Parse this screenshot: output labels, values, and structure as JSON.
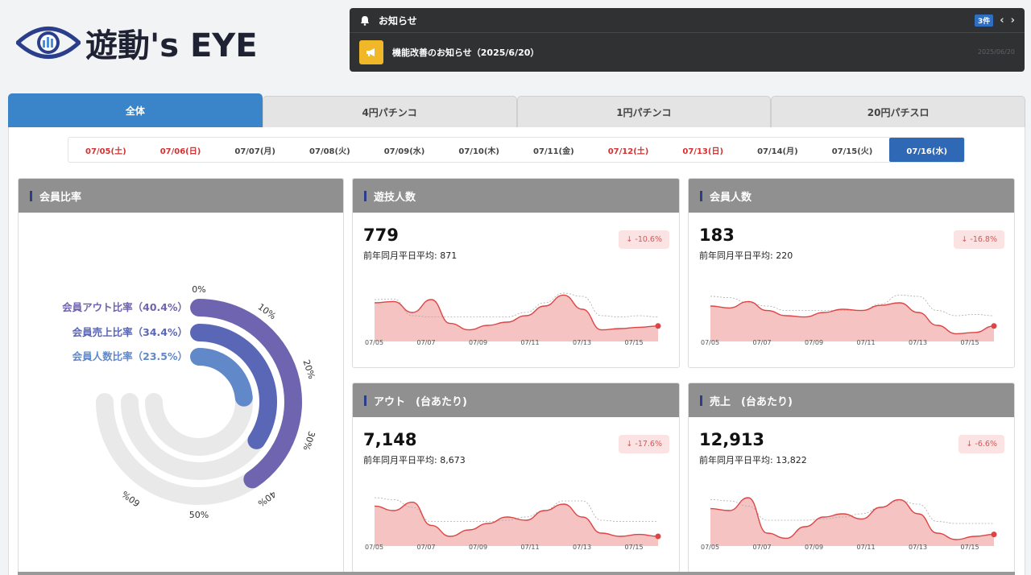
{
  "brand": {
    "logo_text": "遊動's EYE"
  },
  "news": {
    "title": "お知らせ",
    "count": "3件",
    "item_text": "機能改善のお知らせ（2025/6/20）",
    "item_date": "2025/06/20"
  },
  "tabs": [
    {
      "label": "全体",
      "active": true
    },
    {
      "label": "4円パチンコ",
      "active": false
    },
    {
      "label": "1円パチンコ",
      "active": false
    },
    {
      "label": "20円パチスロ",
      "active": false
    }
  ],
  "dates": [
    {
      "label": "07/05(土)",
      "holiday": true,
      "active": false
    },
    {
      "label": "07/06(日)",
      "holiday": true,
      "active": false
    },
    {
      "label": "07/07(月)",
      "holiday": false,
      "active": false
    },
    {
      "label": "07/08(火)",
      "holiday": false,
      "active": false
    },
    {
      "label": "07/09(水)",
      "holiday": false,
      "active": false
    },
    {
      "label": "07/10(木)",
      "holiday": false,
      "active": false
    },
    {
      "label": "07/11(金)",
      "holiday": false,
      "active": false
    },
    {
      "label": "07/12(土)",
      "holiday": true,
      "active": false
    },
    {
      "label": "07/13(日)",
      "holiday": true,
      "active": false
    },
    {
      "label": "07/14(月)",
      "holiday": false,
      "active": false
    },
    {
      "label": "07/15(火)",
      "holiday": false,
      "active": false
    },
    {
      "label": "07/16(水)",
      "holiday": false,
      "active": true
    }
  ],
  "ratio_card": {
    "title": "会員比率",
    "series": [
      {
        "label": "会員アウト比率（40.4%）",
        "value": 40.4,
        "color": "#6f64b0"
      },
      {
        "label": "会員売上比率（34.4%）",
        "value": 34.4,
        "color": "#5a67b6"
      },
      {
        "label": "会員人数比率（23.5%）",
        "value": 23.5,
        "color": "#6189c9"
      }
    ],
    "ticks": [
      "0%",
      "10%",
      "20%",
      "30%",
      "40%",
      "50%",
      "60%"
    ]
  },
  "metric_cards": [
    {
      "title": "遊技人数",
      "value": "779",
      "avg_label": "前年同月平日平均: 871",
      "delta": "↓ -10.6%",
      "series": [
        60,
        62,
        45,
        65,
        28,
        18,
        25,
        30,
        40,
        55,
        72,
        50,
        18,
        20,
        22,
        24
      ],
      "prev": [
        65,
        66,
        40,
        38,
        38,
        38,
        38,
        38,
        45,
        60,
        75,
        70,
        40,
        38,
        40,
        38
      ]
    },
    {
      "title": "会員人数",
      "value": "183",
      "avg_label": "前年同月平日平均: 220",
      "delta": "↓ -16.8%",
      "series": [
        55,
        52,
        62,
        48,
        40,
        38,
        45,
        50,
        48,
        56,
        60,
        45,
        25,
        12,
        14,
        24
      ],
      "prev": [
        70,
        68,
        60,
        55,
        48,
        48,
        48,
        48,
        48,
        58,
        72,
        70,
        48,
        40,
        42,
        40
      ]
    },
    {
      "title": "アウト　(台あたり)",
      "value": "7,148",
      "avg_label": "前年同月平日平均: 8,673",
      "delta": "↓ -17.6%",
      "series": [
        62,
        55,
        68,
        32,
        15,
        25,
        35,
        45,
        40,
        55,
        65,
        45,
        20,
        15,
        18,
        15
      ],
      "prev": [
        75,
        72,
        60,
        38,
        38,
        38,
        38,
        40,
        45,
        55,
        70,
        70,
        40,
        38,
        38,
        38
      ]
    },
    {
      "title": "売上　(台あたり)",
      "value": "12,913",
      "avg_label": "前年同月平日平均: 13,822",
      "delta": "↓ -6.6%",
      "series": [
        58,
        55,
        75,
        20,
        12,
        30,
        45,
        50,
        42,
        60,
        72,
        50,
        20,
        10,
        15,
        18
      ],
      "prev": [
        72,
        70,
        62,
        40,
        40,
        40,
        42,
        45,
        50,
        60,
        70,
        65,
        38,
        35,
        35,
        35
      ]
    }
  ],
  "x_labels": [
    "07/05",
    "07/07",
    "07/09",
    "07/11",
    "07/13",
    "07/15"
  ]
}
